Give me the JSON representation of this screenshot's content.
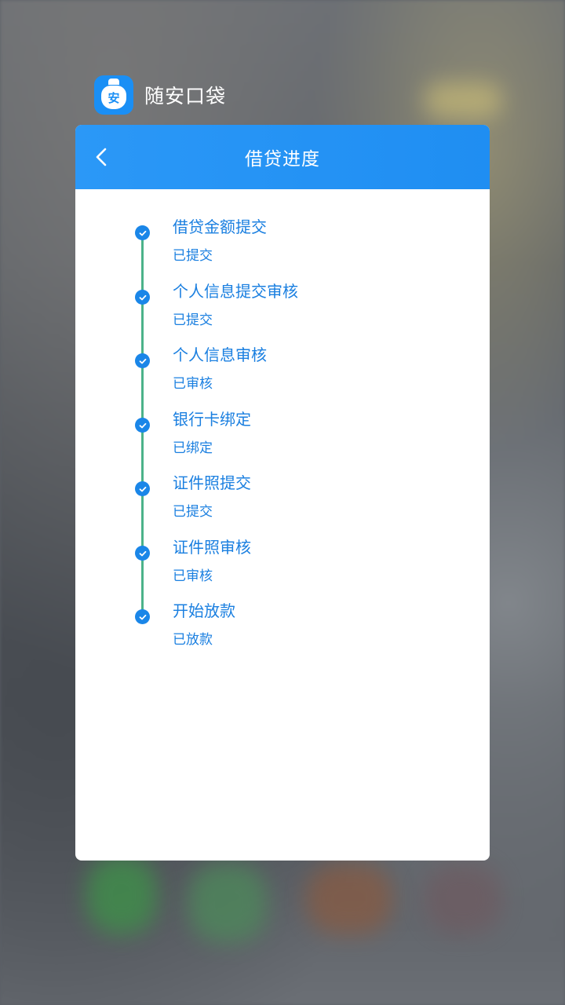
{
  "app": {
    "name": "随安口袋",
    "icon_char": "安",
    "brand_color": "#1a8ff5"
  },
  "navbar": {
    "title": "借贷进度",
    "back_icon": "chevron-left-icon"
  },
  "timeline": {
    "line_color": "#4cb28a",
    "dot_color": "#1a86e8",
    "text_color": "#1a7fe0",
    "steps": [
      {
        "title": "借贷金额提交",
        "status": "已提交"
      },
      {
        "title": "个人信息提交审核",
        "status": "已提交"
      },
      {
        "title": "个人信息审核",
        "status": "已审核"
      },
      {
        "title": "银行卡绑定",
        "status": "已绑定"
      },
      {
        "title": "证件照提交",
        "status": "已提交"
      },
      {
        "title": "证件照审核",
        "status": "已审核"
      },
      {
        "title": "开始放款",
        "status": "已放款"
      }
    ]
  }
}
